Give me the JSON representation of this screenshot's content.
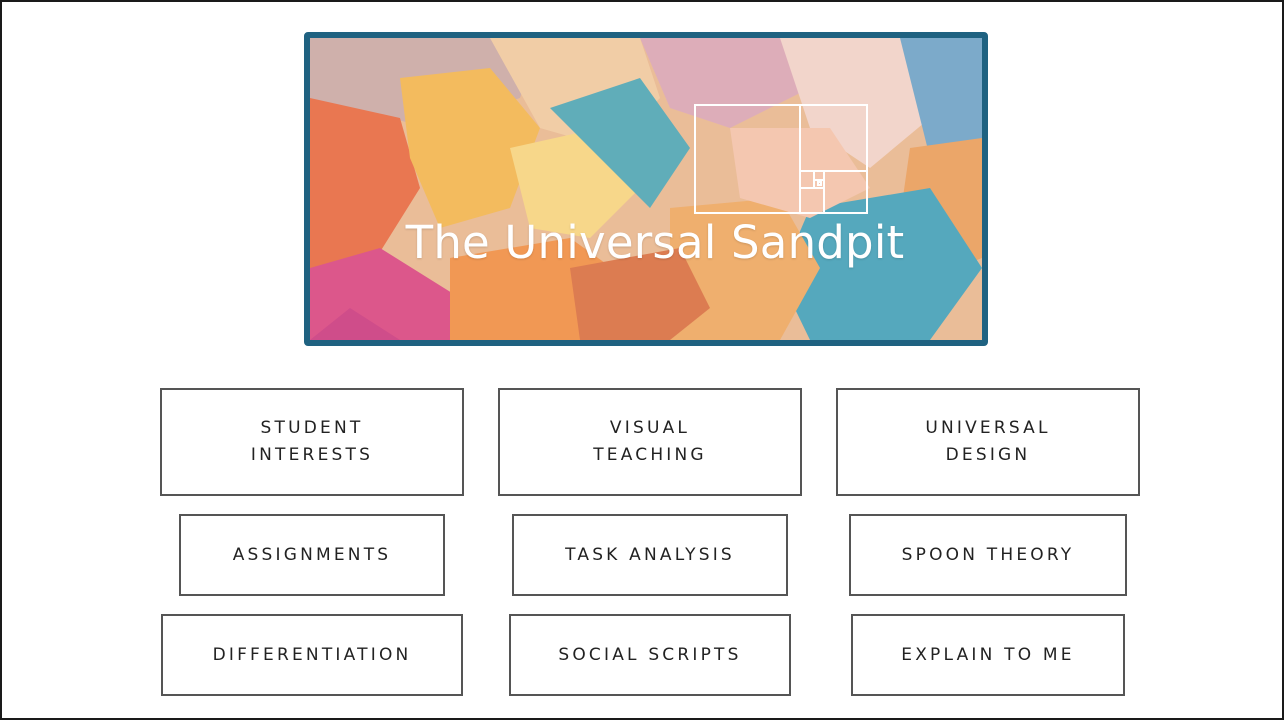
{
  "banner": {
    "title": "The Universal Sandpit",
    "border_color": "#1f6281"
  },
  "nav": {
    "buttons": [
      {
        "id": "student-interests",
        "label": "STUDENT\nINTERESTS"
      },
      {
        "id": "visual-teaching",
        "label": "VISUAL\nTEACHING"
      },
      {
        "id": "universal-design",
        "label": "UNIVERSAL\nDESIGN"
      },
      {
        "id": "assignments",
        "label": "ASSIGNMENTS"
      },
      {
        "id": "task-analysis",
        "label": "TASK ANALYSIS"
      },
      {
        "id": "spoon-theory",
        "label": "SPOON THEORY"
      },
      {
        "id": "differentiation",
        "label": "DIFFERENTIATION"
      },
      {
        "id": "social-scripts",
        "label": "SOCIAL SCRIPTS"
      },
      {
        "id": "explain-to-me",
        "label": "EXPLAIN TO ME"
      }
    ]
  }
}
